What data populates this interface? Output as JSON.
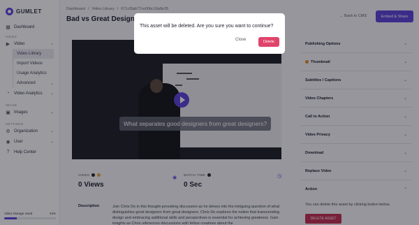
{
  "app": {
    "logo_text": "GUMLET"
  },
  "sidebar": {
    "dashboard": "Dashboard",
    "section_video": "VIDEO",
    "video": "Video",
    "video_library": "Video Library",
    "import_videos": "Import Videos",
    "usage_analytics": "Usage Analytics",
    "advanced": "Advanced",
    "video_analytics": "Video Analytics",
    "section_image": "IMAGE",
    "images": "Images",
    "section_settings": "SETTINGS",
    "organization": "Organization",
    "user": "User",
    "help_center": "Help Center",
    "storage_label": "Video Storage Used",
    "storage_percent": "24%",
    "storage_fraction": 0.24
  },
  "breadcrumb": {
    "dashboard": "Dashboard",
    "sep1": "/",
    "video_library": "Video Library",
    "sep2": "/",
    "asset_id": "671cf3ab77ce00bc16a8e35"
  },
  "header": {
    "title": "Bad vs Great Designer",
    "back_link": "← Back to CMS",
    "embed_button": "Embed & Share"
  },
  "video": {
    "caption": "What separates good designers from great designers?"
  },
  "stats": {
    "views_label": "VIEWS",
    "views_value": "0 Views",
    "watch_label": "WATCH TIME",
    "watch_value": "0 Sec"
  },
  "description": {
    "label": "Description",
    "text": "Join Chris Do in this thought-provoking discussion as he delves into the intriguing question of what distinguishes good designers from great designers. Chris Do explores the notion that transcending design and embracing additional skills and perspectives is essential for achieving greatness. Gain insights as Chris references discussions with fellow creatives about the"
  },
  "panel": {
    "publishing_options": "Publishing Options",
    "thumbnail": "Thumbnail",
    "subtitles": "Subtitles / Captions",
    "chapters": "Video Chapters",
    "cta": "Call to Action",
    "privacy": "Video Privacy",
    "download": "Download",
    "replace": "Replace Video",
    "action": "Action",
    "action_text": "You can delete this asset by clicking button below.",
    "delete_asset": "DELETE ASSET"
  },
  "modal": {
    "message": "This asset will be deleted. Are you sure you want to continue?",
    "close": "Close",
    "delete": "Delete"
  },
  "colors": {
    "accent": "#5b3fd6",
    "danger": "#e0446a",
    "delete_asset": "#c22a4c",
    "warning": "#e38a1a"
  }
}
